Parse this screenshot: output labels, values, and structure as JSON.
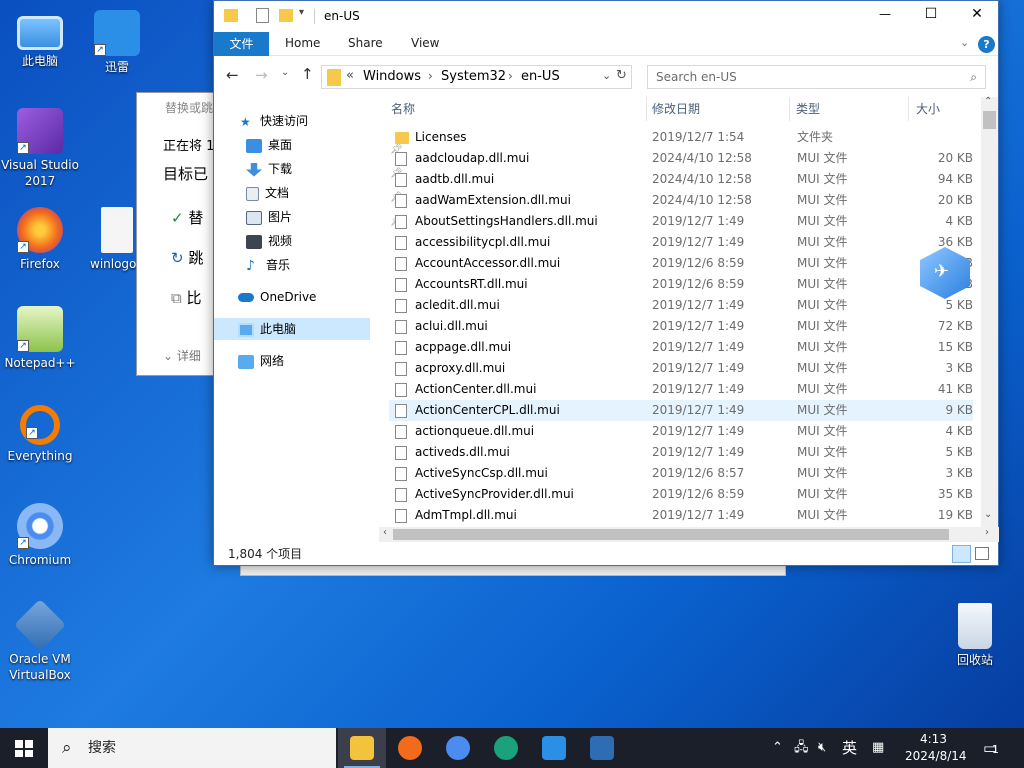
{
  "desktop": {
    "icons": [
      {
        "label": "此电脑",
        "icon": "computer-icon",
        "color": "#4aa3f0"
      },
      {
        "label": "迅雷",
        "icon": "thunder-bird-icon",
        "color": "#2b8fe8"
      },
      {
        "label": "Visual Studio 2017",
        "icon": "visual-studio-icon",
        "color": "#7a3ec8"
      },
      {
        "label": "Firefox",
        "icon": "firefox-icon",
        "color": "#f26a1b"
      },
      {
        "label": "winlogon",
        "icon": "file-icon",
        "color": "#f5f5f5"
      },
      {
        "label": "Notepad++",
        "icon": "notepadpp-icon",
        "color": "#8bc34a"
      },
      {
        "label": "Everything",
        "icon": "everything-icon",
        "color": "#f57c00"
      },
      {
        "label": "Chromium",
        "icon": "chromium-icon",
        "color": "#4a8cf0"
      },
      {
        "label": "Oracle VM VirtualBox",
        "icon": "virtualbox-icon",
        "color": "#2e6db4"
      },
      {
        "label": "回收站",
        "icon": "recycle-bin-icon",
        "color": "#dfe8f3"
      }
    ]
  },
  "bg_dialog": {
    "title": "替换或跳",
    "line1": "正在将 1",
    "line2": "目标已",
    "opt1": "替",
    "opt2": "跳",
    "opt3": "比",
    "details": "详细"
  },
  "window": {
    "title": "en-US",
    "controls": {
      "minimize": "—",
      "maximize": "☐",
      "close": "✕"
    },
    "ribbon": {
      "file": "文件",
      "home": "Home",
      "share": "Share",
      "view": "View"
    },
    "address": {
      "prefix": "«",
      "crumbs": [
        "Windows",
        "System32",
        "en-US"
      ]
    },
    "search_placeholder": "Search en-US",
    "nav": {
      "quick_access": "快速访问",
      "items": [
        {
          "label": "桌面",
          "icon": "desktop-icon",
          "pinned": true
        },
        {
          "label": "下载",
          "icon": "download-icon",
          "pinned": true
        },
        {
          "label": "文档",
          "icon": "documents-icon",
          "pinned": true
        },
        {
          "label": "图片",
          "icon": "pictures-icon",
          "pinned": true
        },
        {
          "label": "视频",
          "icon": "video-icon",
          "pinned": false
        },
        {
          "label": "音乐",
          "icon": "music-icon",
          "pinned": false
        }
      ],
      "onedrive": "OneDrive",
      "this_pc": "此电脑",
      "network": "网络"
    },
    "columns": {
      "name": "名称",
      "date": "修改日期",
      "type": "类型",
      "size": "大小"
    },
    "files": [
      {
        "name": "Licenses",
        "date": "2019/12/7 1:54",
        "type": "文件夹",
        "size": "",
        "folder": true
      },
      {
        "name": "aadcloudap.dll.mui",
        "date": "2024/4/10 12:58",
        "type": "MUI 文件",
        "size": "20 KB"
      },
      {
        "name": "aadtb.dll.mui",
        "date": "2024/4/10 12:58",
        "type": "MUI 文件",
        "size": "94 KB"
      },
      {
        "name": "aadWamExtension.dll.mui",
        "date": "2024/4/10 12:58",
        "type": "MUI 文件",
        "size": "20 KB"
      },
      {
        "name": "AboutSettingsHandlers.dll.mui",
        "date": "2019/12/7 1:49",
        "type": "MUI 文件",
        "size": "4 KB"
      },
      {
        "name": "accessibilitycpl.dll.mui",
        "date": "2019/12/7 1:49",
        "type": "MUI 文件",
        "size": "36 KB"
      },
      {
        "name": "AccountAccessor.dll.mui",
        "date": "2019/12/6 8:59",
        "type": "MUI 文件",
        "size": "KB"
      },
      {
        "name": "AccountsRT.dll.mui",
        "date": "2019/12/6 8:59",
        "type": "MUI 文件",
        "size": "KB"
      },
      {
        "name": "acledit.dll.mui",
        "date": "2019/12/7 1:49",
        "type": "MUI 文件",
        "size": "5 KB"
      },
      {
        "name": "aclui.dll.mui",
        "date": "2019/12/7 1:49",
        "type": "MUI 文件",
        "size": "72 KB"
      },
      {
        "name": "acppage.dll.mui",
        "date": "2019/12/7 1:49",
        "type": "MUI 文件",
        "size": "15 KB"
      },
      {
        "name": "acproxy.dll.mui",
        "date": "2019/12/7 1:49",
        "type": "MUI 文件",
        "size": "3 KB"
      },
      {
        "name": "ActionCenter.dll.mui",
        "date": "2019/12/7 1:49",
        "type": "MUI 文件",
        "size": "41 KB"
      },
      {
        "name": "ActionCenterCPL.dll.mui",
        "date": "2019/12/7 1:49",
        "type": "MUI 文件",
        "size": "9 KB",
        "hover": true
      },
      {
        "name": "actionqueue.dll.mui",
        "date": "2019/12/7 1:49",
        "type": "MUI 文件",
        "size": "4 KB"
      },
      {
        "name": "activeds.dll.mui",
        "date": "2019/12/7 1:49",
        "type": "MUI 文件",
        "size": "5 KB"
      },
      {
        "name": "ActiveSyncCsp.dll.mui",
        "date": "2019/12/6 8:57",
        "type": "MUI 文件",
        "size": "3 KB"
      },
      {
        "name": "ActiveSyncProvider.dll.mui",
        "date": "2019/12/6 8:59",
        "type": "MUI 文件",
        "size": "35 KB"
      },
      {
        "name": "AdmTmpl.dll.mui",
        "date": "2019/12/7 1:49",
        "type": "MUI 文件",
        "size": "19 KB"
      }
    ],
    "status": "1,804 个项目"
  },
  "taskbar": {
    "search": "搜索",
    "apps": [
      {
        "icon": "file-explorer-icon",
        "color": "#f3c33c",
        "active": true
      },
      {
        "icon": "firefox-icon",
        "color": "#f26a1b",
        "active": false
      },
      {
        "icon": "chromium-icon",
        "color": "#4a8cf0",
        "active": false
      },
      {
        "icon": "edge-icon",
        "color": "#1aa37a",
        "active": false
      },
      {
        "icon": "thunder-bird-icon",
        "color": "#2b8fe8",
        "active": false
      },
      {
        "icon": "virtualbox-icon",
        "color": "#2e6db4",
        "active": false
      }
    ],
    "ime": "英",
    "time": "4:13",
    "date": "2024/8/14",
    "notifications": "1"
  }
}
